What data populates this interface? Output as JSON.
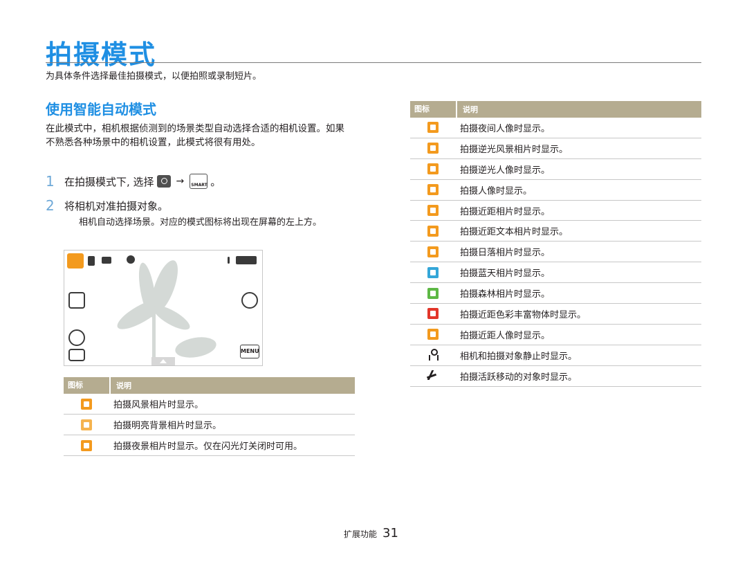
{
  "page": {
    "title": "拍摄模式",
    "intro": "为具体条件选择最佳拍摄模式，以便拍照或录制短片。",
    "subtitle": "使用智能自动模式",
    "paragraph": "在此模式中，相机根据侦测到的场景类型自动选择合适的相机设置。如果不熟悉各种场景中的相机设置，此模式将很有用处。"
  },
  "steps": [
    {
      "num": "1",
      "text_before": "在拍摄模式下, 选择",
      "arrow": "→",
      "text_after": "。"
    },
    {
      "num": "2",
      "text": "将相机对准拍摄对象。",
      "note": "相机自动选择场景。对应的模式图标将出现在屏幕的左上方。"
    }
  ],
  "screen": {
    "menu_label": "MENU"
  },
  "table_left": {
    "headers": [
      "图标",
      "说明"
    ],
    "rows": [
      {
        "icon": "landscape-icon",
        "text": "拍摄风景相片时显示。"
      },
      {
        "icon": "white-icon",
        "text": "拍摄明亮背景相片时显示。"
      },
      {
        "icon": "night-icon",
        "text": "拍摄夜景相片时显示。仅在闪光灯关闭时可用。"
      }
    ]
  },
  "table_right": {
    "headers": [
      "图标",
      "说明"
    ],
    "rows": [
      {
        "icon": "night-portrait-icon",
        "text": "拍摄夜间人像时显示。"
      },
      {
        "icon": "backlight-landscape-icon",
        "text": "拍摄逆光风景相片时显示。"
      },
      {
        "icon": "backlight-portrait-icon",
        "text": "拍摄逆光人像时显示。"
      },
      {
        "icon": "portrait-icon",
        "text": "拍摄人像时显示。"
      },
      {
        "icon": "macro-icon",
        "text": "拍摄近距相片时显示。"
      },
      {
        "icon": "macro-text-icon",
        "text": "拍摄近距文本相片时显示。"
      },
      {
        "icon": "sunset-icon",
        "text": "拍摄日落相片时显示。"
      },
      {
        "icon": "blue-sky-icon",
        "text": "拍摄蓝天相片时显示。"
      },
      {
        "icon": "forest-icon",
        "text": "拍摄森林相片时显示。"
      },
      {
        "icon": "macro-color-icon",
        "text": "拍摄近距色彩丰富物体时显示。"
      },
      {
        "icon": "macro-portrait-icon",
        "text": "拍摄近距人像时显示。"
      },
      {
        "icon": "tripod-icon",
        "text": "相机和拍摄对象静止时显示。"
      },
      {
        "icon": "action-icon",
        "text": "拍摄活跃移动的对象时显示。"
      }
    ]
  },
  "footer": {
    "section": "扩展功能",
    "page_number": "31"
  }
}
